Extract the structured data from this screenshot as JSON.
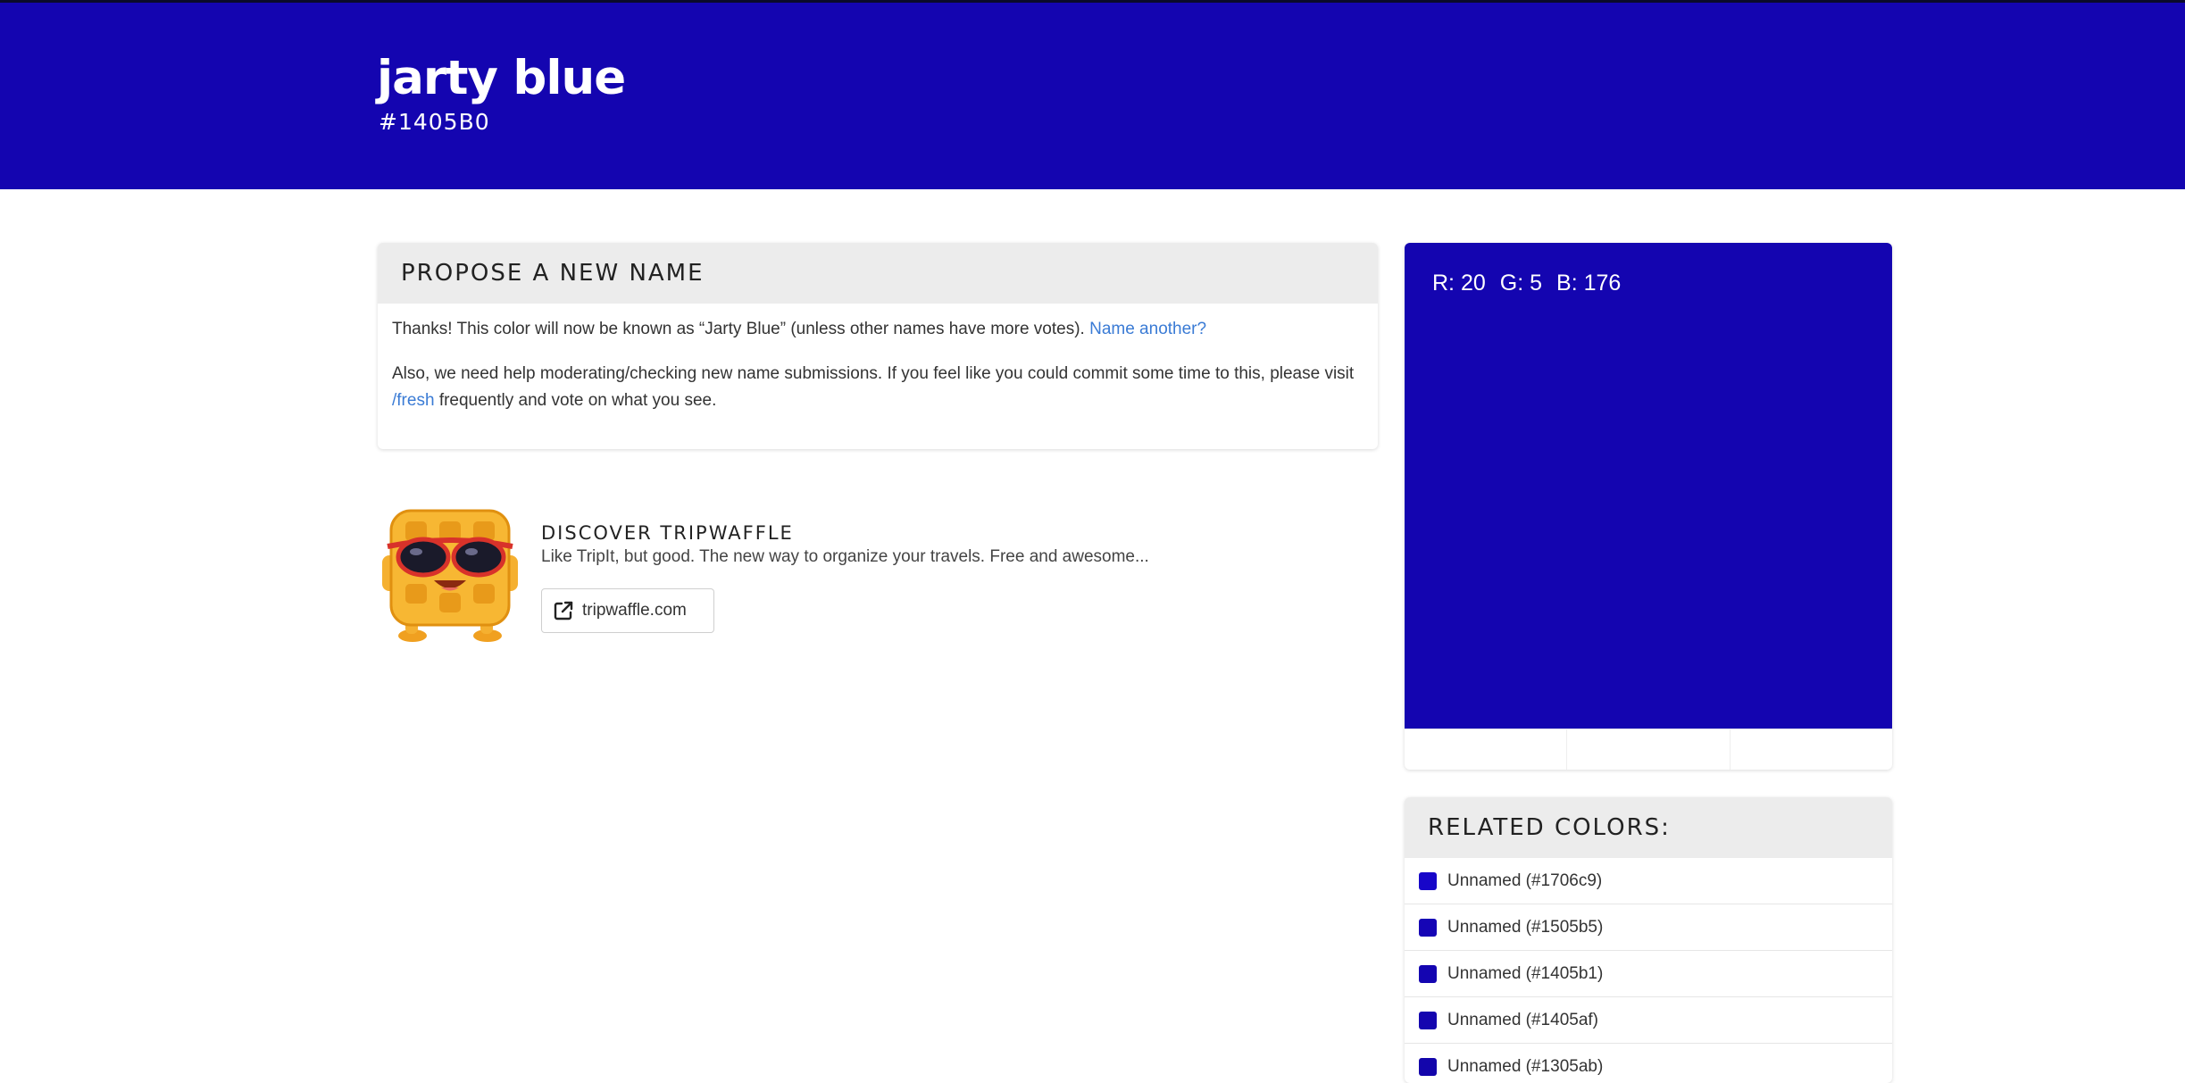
{
  "color": {
    "name": "jarty blue",
    "hex": "#1405B0",
    "swatch_color": "#1405b0",
    "rgb": {
      "r_label": "R: 20",
      "g_label": "G: 5",
      "b_label": "B: 176"
    }
  },
  "propose": {
    "heading": "PROPOSE A NEW NAME",
    "thanks_text": "Thanks! This color will now be known as “Jarty Blue” (unless other names have more votes).",
    "name_another_link": "Name another?",
    "help_text_before": "Also, we need help moderating/checking new name submissions. If you feel like you could commit some time to this, please visit",
    "fresh_link": "/fresh",
    "help_text_after": "frequently and vote on what you see."
  },
  "discover": {
    "title": "DISCOVER TRIPWAFFLE",
    "description": "Like TripIt, but good. The new way to organize your travels. Free and awesome...",
    "button_label": "tripwaffle.com",
    "icon": "external-link-icon"
  },
  "related": {
    "heading": "RELATED COLORS:",
    "items": [
      {
        "label": "Unnamed (#1706c9)",
        "color": "#1706c9"
      },
      {
        "label": "Unnamed (#1505b5)",
        "color": "#1505b5"
      },
      {
        "label": "Unnamed (#1405b1)",
        "color": "#1405b1"
      },
      {
        "label": "Unnamed (#1405af)",
        "color": "#1405af"
      },
      {
        "label": "Unnamed (#1305ab)",
        "color": "#1305ab"
      }
    ]
  },
  "colors": {
    "link": "#3a7bd5",
    "header_bg": "#ececec"
  }
}
